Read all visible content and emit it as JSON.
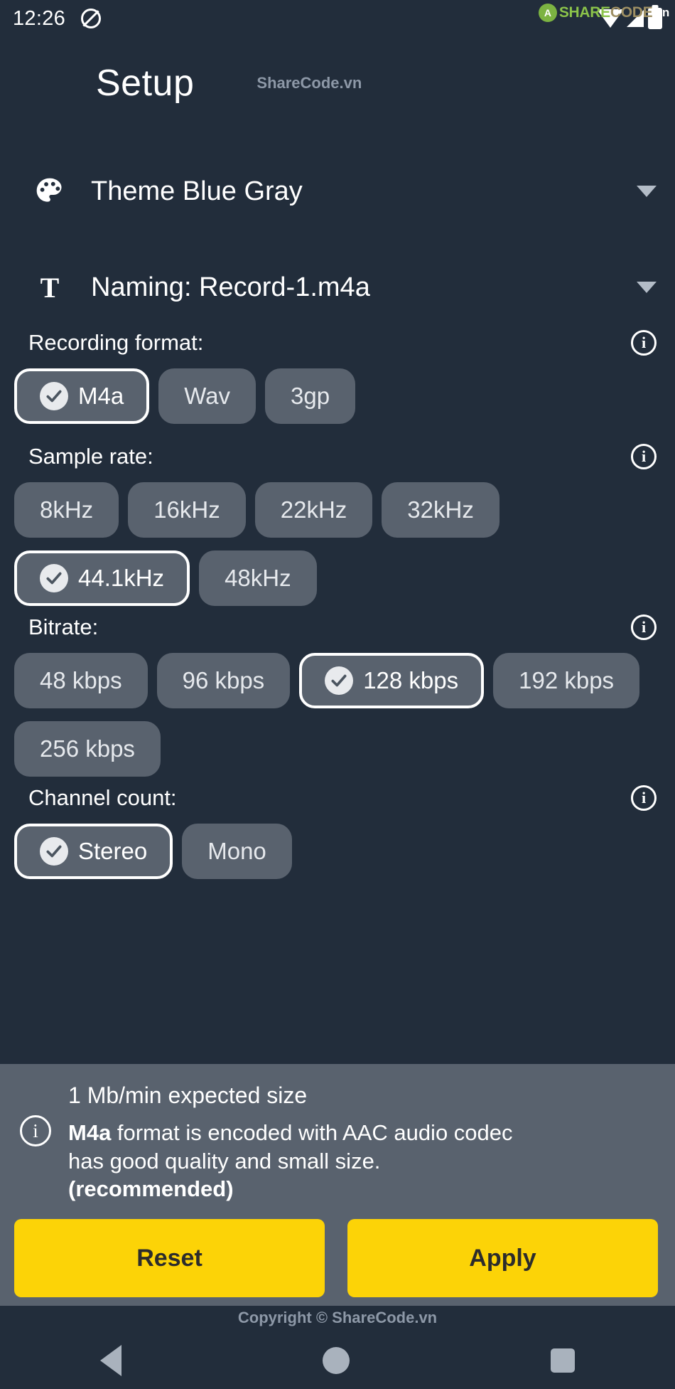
{
  "statusbar": {
    "time": "12:26",
    "dnd_icon": "do-not-disturb-icon",
    "wifi_icon": "wifi-icon",
    "signal_icon": "signal-icon",
    "battery_icon": "battery-icon",
    "watermark": {
      "logo": "A",
      "share": "SHARE",
      "code": "CODE",
      "vn": ".vn"
    }
  },
  "header": {
    "title": "Setup",
    "watermark": "ShareCode.vn"
  },
  "settings_rows": [
    {
      "icon": "palette-icon",
      "label": "Theme Blue Gray",
      "caret": "chevron-down-icon"
    },
    {
      "icon": "text-format-icon",
      "label": "Naming: Record-1.m4a",
      "caret": "chevron-down-icon"
    }
  ],
  "sections": [
    {
      "id": "recording-format",
      "title": "Recording format:",
      "info_icon": "info-icon",
      "options": [
        {
          "label": "M4a",
          "selected": true
        },
        {
          "label": "Wav",
          "selected": false
        },
        {
          "label": "3gp",
          "selected": false
        }
      ]
    },
    {
      "id": "sample-rate",
      "title": "Sample rate:",
      "info_icon": "info-icon",
      "options": [
        {
          "label": "8kHz",
          "selected": false
        },
        {
          "label": "16kHz",
          "selected": false
        },
        {
          "label": "22kHz",
          "selected": false
        },
        {
          "label": "32kHz",
          "selected": false
        },
        {
          "label": "44.1kHz",
          "selected": true
        },
        {
          "label": "48kHz",
          "selected": false
        }
      ]
    },
    {
      "id": "bitrate",
      "title": "Bitrate:",
      "info_icon": "info-icon",
      "options": [
        {
          "label": "48 kbps",
          "selected": false
        },
        {
          "label": "96 kbps",
          "selected": false
        },
        {
          "label": "128 kbps",
          "selected": true
        },
        {
          "label": "192 kbps",
          "selected": false
        },
        {
          "label": "256 kbps",
          "selected": false
        }
      ]
    },
    {
      "id": "channel-count",
      "title": "Channel count:",
      "info_icon": "info-icon",
      "options": [
        {
          "label": "Stereo",
          "selected": true
        },
        {
          "label": "Mono",
          "selected": false
        }
      ]
    }
  ],
  "info_panel": {
    "icon": "info-icon",
    "expected_size": "1 Mb/min expected size",
    "description_bold_prefix": "M4a",
    "description_middle": " format is encoded with AAC audio codec has good quality and small size. ",
    "description_bold_suffix": "(recommended)"
  },
  "actions": {
    "reset_label": "Reset",
    "apply_label": "Apply",
    "accent_color": "#fcd307"
  },
  "footer": {
    "copyright": "Copyright © ShareCode.vn",
    "nav": {
      "back": "back-icon",
      "home": "home-icon",
      "recents": "recents-icon"
    }
  },
  "colors": {
    "background": "#222d3b",
    "chip": "#59626e",
    "panel": "#59626e",
    "accent": "#fcd307",
    "text": "#ffffff"
  }
}
